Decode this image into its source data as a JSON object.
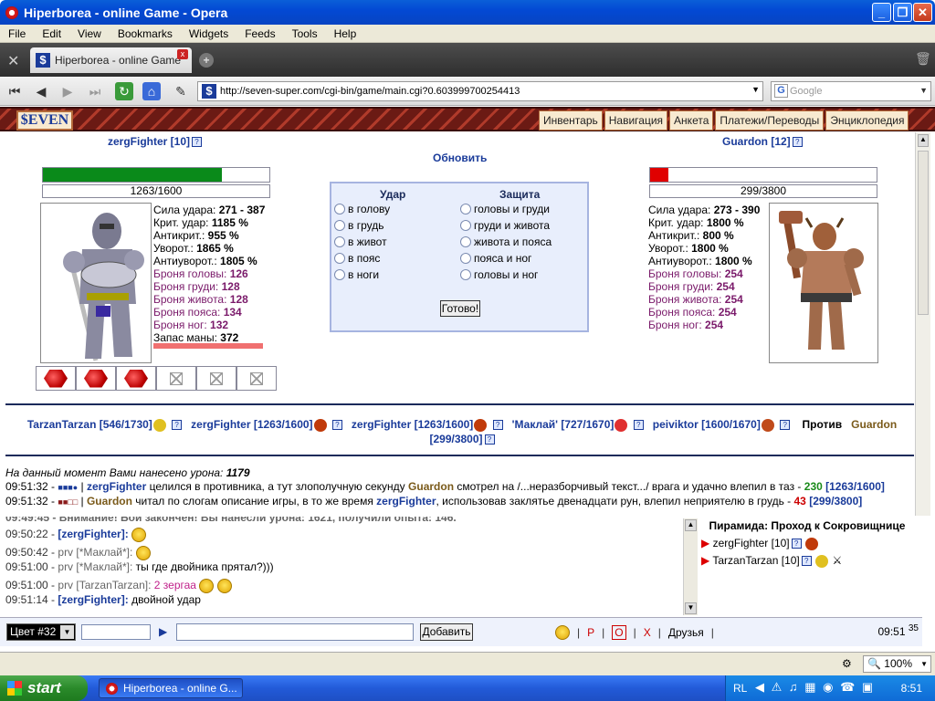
{
  "window": {
    "title": "Hiperborea - online Game - Opera"
  },
  "menu": [
    "File",
    "Edit",
    "View",
    "Bookmarks",
    "Widgets",
    "Feeds",
    "Tools",
    "Help"
  ],
  "tab": {
    "favicon": "$",
    "title": "Hiperborea - online Game"
  },
  "address": {
    "favicon": "$",
    "url": "http://seven-super.com/cgi-bin/game/main.cgi?0.603999700254413"
  },
  "search": {
    "placeholder": "Google"
  },
  "gamenav": {
    "logo": "$EVEN",
    "links": [
      "Инвентарь",
      "Навигация",
      "Анкета",
      "Платежи/Переводы",
      "Энциклопедия"
    ]
  },
  "player": {
    "name": "zergFighter [10]",
    "hp_text": "1263/1600",
    "hp_fraction": 0.79,
    "stats": [
      {
        "label": "Сила удара:",
        "value": "271 - 387",
        "armor": false
      },
      {
        "label": "Крит. удар:",
        "value": "1185 %",
        "armor": false
      },
      {
        "label": "Антикрит.:",
        "value": "955 %",
        "armor": false
      },
      {
        "label": "Уворот.:",
        "value": "1865 %",
        "armor": false
      },
      {
        "label": "Антиуворот.:",
        "value": "1805 %",
        "armor": false
      },
      {
        "label": "Броня головы:",
        "value": "126",
        "armor": true
      },
      {
        "label": "Броня груди:",
        "value": "128",
        "armor": true
      },
      {
        "label": "Броня живота:",
        "value": "128",
        "armor": true
      },
      {
        "label": "Броня пояса:",
        "value": "134",
        "armor": true
      },
      {
        "label": "Броня ног:",
        "value": "132",
        "armor": true
      },
      {
        "label": "Запас маны:",
        "value": "372",
        "armor": false
      }
    ],
    "hp_color": "#0a8a1a"
  },
  "enemy": {
    "name": "Guardon [12]",
    "hp_text": "299/3800",
    "hp_fraction": 0.08,
    "stats": [
      {
        "label": "Сила удара:",
        "value": "273 - 390",
        "armor": false
      },
      {
        "label": "Крит. удар:",
        "value": "1800 %",
        "armor": false
      },
      {
        "label": "Антикрит.:",
        "value": "800 %",
        "armor": false
      },
      {
        "label": "Уворот.:",
        "value": "1800 %",
        "armor": false
      },
      {
        "label": "Антиуворот.:",
        "value": "1800 %",
        "armor": false
      },
      {
        "label": "Броня головы:",
        "value": "254",
        "armor": true
      },
      {
        "label": "Броня груди:",
        "value": "254",
        "armor": true
      },
      {
        "label": "Броня живота:",
        "value": "254",
        "armor": true
      },
      {
        "label": "Броня пояса:",
        "value": "254",
        "armor": true
      },
      {
        "label": "Броня ног:",
        "value": "254",
        "armor": true
      }
    ],
    "hp_color": "#e00000"
  },
  "fight": {
    "refresh": "Обновить",
    "attack_header": "Удар",
    "defense_header": "Защита",
    "attack": [
      "в голову",
      "в грудь",
      "в живот",
      "в пояс",
      "в ноги"
    ],
    "defense": [
      "головы и груди",
      "груди и живота",
      "живота и пояса",
      "пояса и ног",
      "головы и ног"
    ],
    "ready": "Готово!"
  },
  "combatants": [
    {
      "name": "TarzanTarzan [546/1730]",
      "icon": "crown-icon"
    },
    {
      "name": "zergFighter [1263/1600]",
      "icon": "shield-icon"
    },
    {
      "name": "zergFighter [1263/1600]",
      "icon": "shield-icon"
    },
    {
      "name": "'Маклай' [727/1670]",
      "icon": "drop-icon"
    },
    {
      "name": "peiviktor [1600/1670]",
      "icon": "demon-icon"
    }
  ],
  "versus": {
    "label": "Против",
    "name": "Guardon",
    "hp": "[299/3800]"
  },
  "log": {
    "damage_label": "На данный момент Вами нанесено урона:",
    "damage_value": "1179",
    "lines": [
      {
        "time": "09:51:32 -",
        "actor": "zergFighter",
        "text1": "целился в противника, а тут злополучную секунду",
        "target": "Guardon",
        "text2": "смотрел на /...неразборчивый текст.../ врага и удачно влепил в таз -",
        "amount": "230",
        "hp": "[1263/1600]",
        "amount_color": "grn"
      },
      {
        "time": "09:51:32 -",
        "actor": "Guardon",
        "text1": "читал по слогам описание игры, в то же время",
        "target": "zergFighter",
        "text2": ", использовав заклятье двенадцати рун, влепил неприятелю в грудь -",
        "amount": "43",
        "hp": "[299/3800]",
        "amount_color": "red"
      }
    ]
  },
  "chat": [
    {
      "time": "09:49:45 -",
      "text": "Внимание! Бой закончен! Вы нанесли урона: 1621, получили опыта: 146."
    },
    {
      "time": "09:50:22 -",
      "who": "[zergFighter]:",
      "prv": "",
      "msg": "",
      "smile": true
    },
    {
      "time": "09:50:42 -",
      "who": "",
      "prv": "prv [*Маклай*]:",
      "msg": "",
      "smile": true
    },
    {
      "time": "09:51:00 -",
      "who": "",
      "prv": "prv [*Маклай*]:",
      "msg": "ты где двойника прятал?)))",
      "smile": false
    },
    {
      "time": "09:51:00 -",
      "who": "",
      "prv": "prv [TarzanTarzan]:",
      "msg": "2 зергаа",
      "smile": true,
      "pink": true
    },
    {
      "time": "09:51:14 -",
      "who": "[zergFighter]:",
      "prv": "",
      "msg": "двойной удар",
      "smile": false
    }
  ],
  "online": {
    "location": "Пирамида: Проход к Сокровищнице",
    "users": [
      "zergFighter [10]",
      "TarzanTarzan [10]"
    ]
  },
  "inputbar": {
    "color": "Цвет #32",
    "add": "Добавить",
    "links": [
      "Р",
      "О",
      "Х",
      "Друзья"
    ],
    "time": "09:51",
    "sec": "35"
  },
  "statusbar": {
    "zoom": "100%"
  },
  "taskbar": {
    "start": "start",
    "item": "Hiperborea - online G...",
    "lang": "RL",
    "time": "8:51"
  }
}
